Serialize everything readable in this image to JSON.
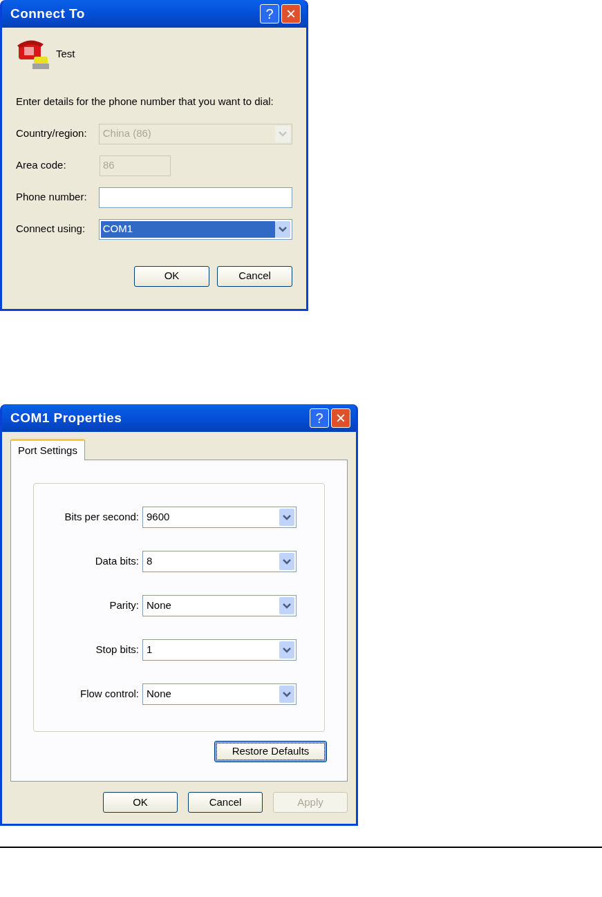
{
  "connect_dialog": {
    "title": "Connect To",
    "help_button": "?",
    "close_button": "×",
    "connection_name": "Test",
    "instruction": "Enter details for the phone number that you want to dial:",
    "fields": [
      {
        "kind": "combo",
        "label": "Country/region:",
        "value": "China (86)",
        "disabled": true,
        "focused": false
      },
      {
        "kind": "short_text",
        "label": "Area code:",
        "value": "86",
        "disabled": true,
        "focused": false
      },
      {
        "kind": "text",
        "label": "Phone number:",
        "disabled": false,
        "focused": false
      },
      {
        "kind": "combo",
        "label": "Connect using:",
        "value": "COM1",
        "disabled": false,
        "focused": true
      }
    ],
    "buttons": [
      {
        "label": "OK",
        "disabled": false,
        "focused": false
      },
      {
        "label": "Cancel",
        "disabled": false,
        "focused": false
      }
    ]
  },
  "properties_dialog": {
    "title": "COM1 Properties",
    "help_button": "?",
    "close_button": "×",
    "tabs": [
      {
        "label": "Port Settings",
        "selected": true
      }
    ],
    "settings": [
      {
        "label": "Bits per second:",
        "value": "9600"
      },
      {
        "label": "Data bits:",
        "value": "8"
      },
      {
        "label": "Parity:",
        "value": "None"
      },
      {
        "label": "Stop bits:",
        "value": "1"
      },
      {
        "label": "Flow control:",
        "value": "None"
      }
    ],
    "restore_button": {
      "label": "Restore Defaults",
      "focused": true
    },
    "buttons": [
      {
        "label": "OK",
        "disabled": false,
        "focused": false
      },
      {
        "label": "Cancel",
        "disabled": false,
        "focused": false
      },
      {
        "label": "Apply",
        "disabled": true,
        "focused": false
      }
    ]
  }
}
